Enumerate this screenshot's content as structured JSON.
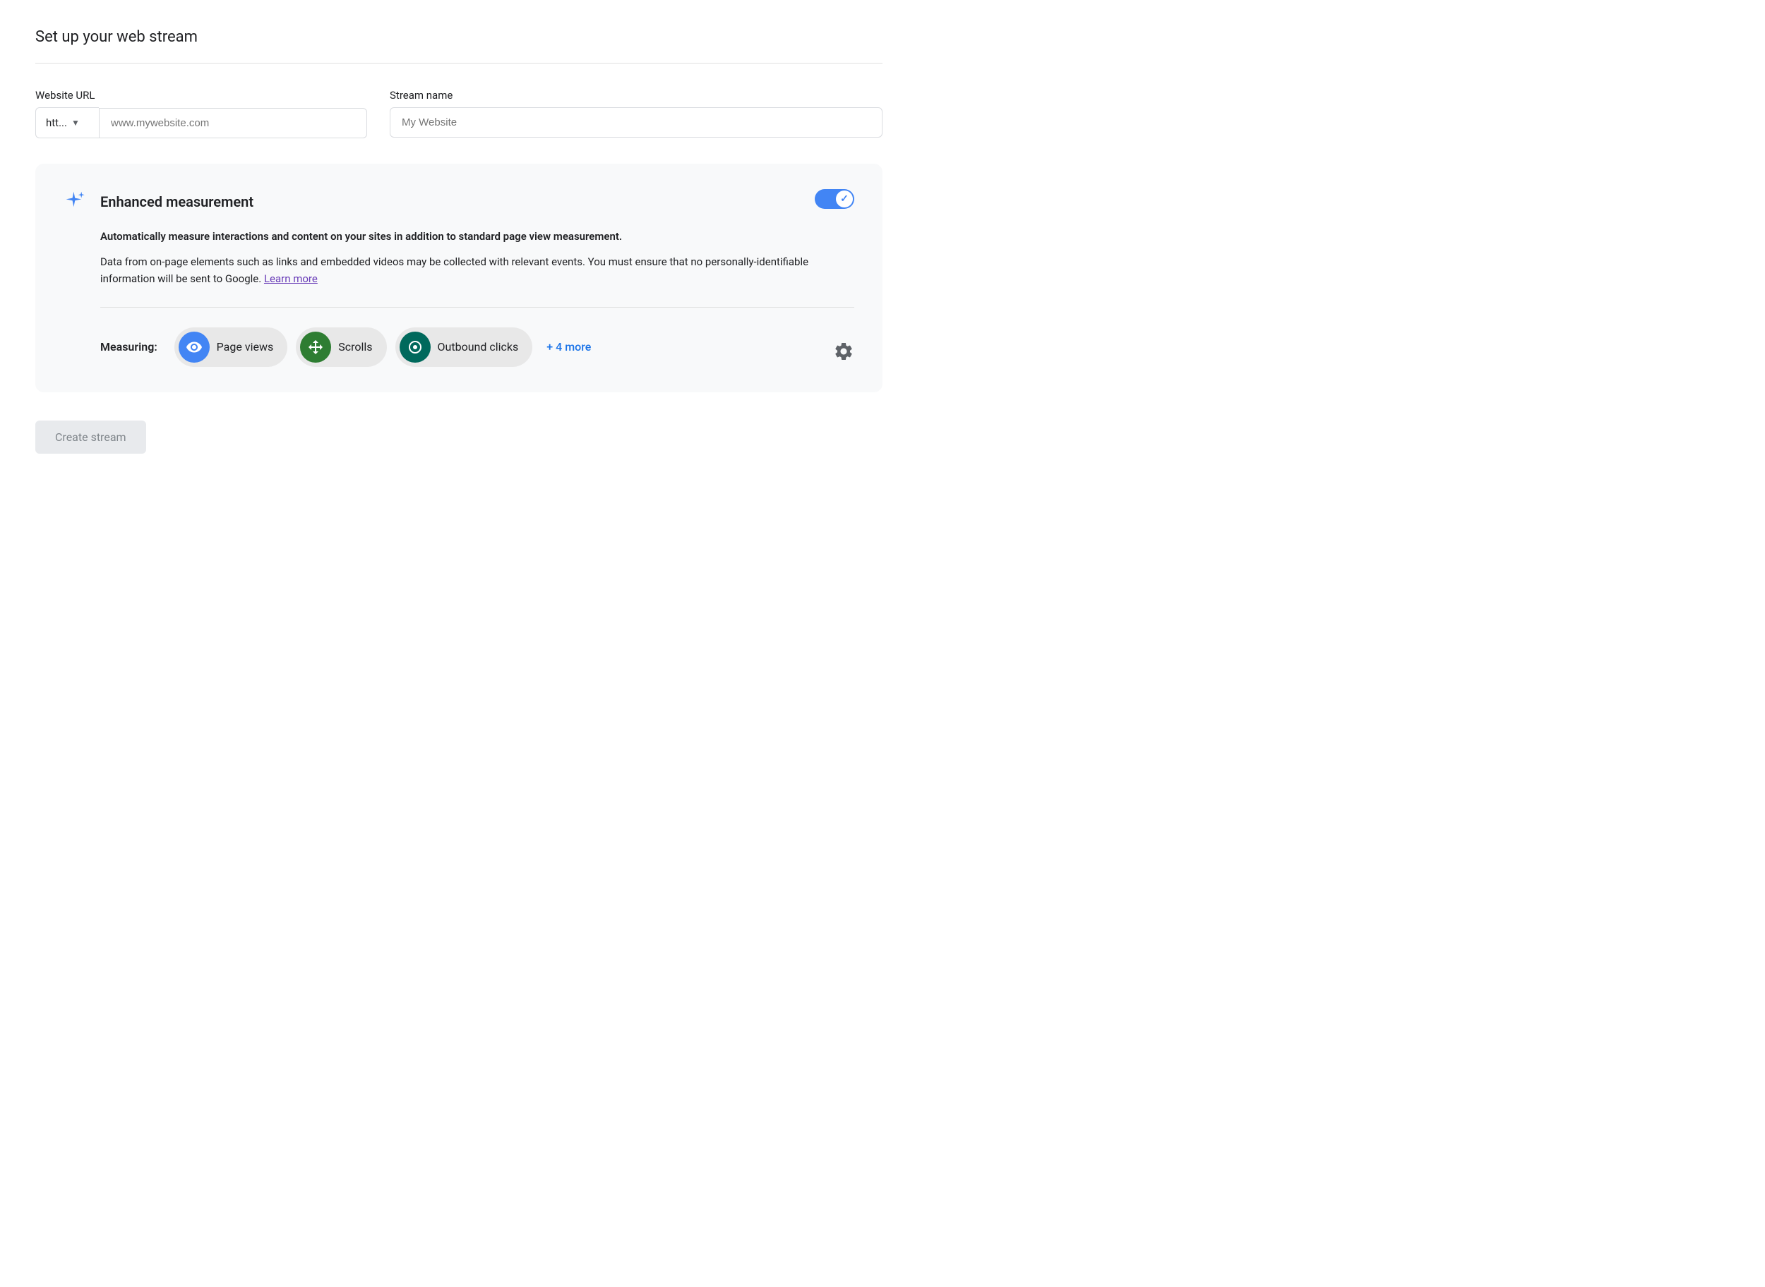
{
  "page": {
    "title": "Set up your web stream"
  },
  "url_section": {
    "website_url_label": "Website URL",
    "protocol_default": "htt...",
    "url_placeholder": "www.mywebsite.com",
    "stream_name_label": "Stream name",
    "stream_name_placeholder": "My Website"
  },
  "enhanced_card": {
    "title": "Enhanced measurement",
    "desc_bold": "Automatically measure interactions and content on your sites in addition to standard page view measurement.",
    "desc_normal": "Data from on-page elements such as links and embedded videos may be collected with relevant events. You must ensure that no personally-identifiable information will be sent to Google.",
    "learn_more_label": "Learn more",
    "toggle_on": true,
    "measuring_label": "Measuring:",
    "chips": [
      {
        "id": "page-views",
        "icon_type": "eye",
        "icon_color": "blue",
        "label": "Page views"
      },
      {
        "id": "scrolls",
        "icon_type": "diamond",
        "icon_color": "green-dark",
        "label": "Scrolls"
      },
      {
        "id": "outbound-clicks",
        "icon_type": "mouse",
        "icon_color": "teal",
        "label": "Outbound clicks"
      }
    ],
    "more_label": "+ 4 more"
  },
  "create_button": {
    "label": "Create stream"
  }
}
